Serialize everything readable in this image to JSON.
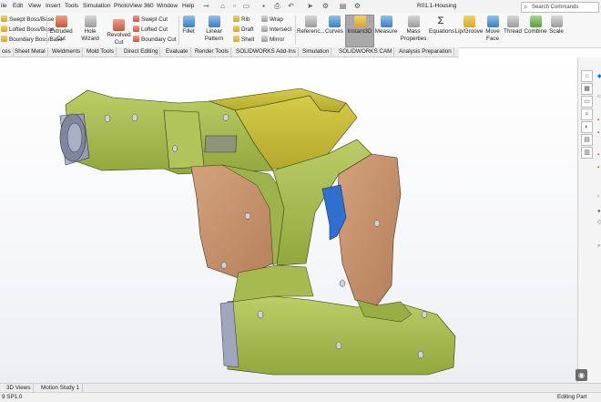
{
  "menubar": {
    "items": [
      "ile",
      "Edit",
      "View",
      "Insert",
      "Tools",
      "Simulation",
      "PhotoView 360",
      "Window",
      "Help"
    ],
    "doc_title": "R01.1-Housing",
    "search_placeholder": "Search Commands"
  },
  "ribbon": {
    "boss_group": [
      "Swept Boss/Base",
      "Lofted Boss/Base",
      "Boundary Boss/Base"
    ],
    "extruded_cut": "Extruded Cut",
    "hole_wizard": "Hole Wizard",
    "revolved_cut": "Revolved Cut",
    "cut_group": [
      "Swept Cut",
      "Lofted Cut",
      "Boundary Cut"
    ],
    "fillet": "Fillet",
    "linear_pattern": "Linear Pattern",
    "features_group": [
      "Rib",
      "Draft",
      "Shell"
    ],
    "features_group2": [
      "Wrap",
      "Intersect",
      "Mirror"
    ],
    "reference": "Referenc...",
    "curves": "Curves",
    "instant3d": "Instant3D",
    "measure": "Measure",
    "mass_properties": "Mass Properties",
    "equations": "Equations",
    "lip_groove": "Lip/Groove",
    "move_face": "Move Face",
    "thread": "Thread",
    "combine": "Combine",
    "scale": "Scale"
  },
  "tabs": [
    "ces",
    "Sheet Metal",
    "Weldments",
    "Mold Tools",
    "Direct Editing",
    "Evaluate",
    "Render Tools",
    "SOLIDWORKS Add-Ins",
    "Simulation",
    "SOLIDWORKS CAM",
    "Analysis Preparation"
  ],
  "bottom_tabs": [
    "3D Views",
    "Motion Study 1"
  ],
  "status": {
    "left": "9 SP1.0",
    "right": "Editing Part"
  },
  "colors": {
    "body_green": "#a9bd52",
    "grip_tan": "#c4906a",
    "trigger_blue": "#2f6fd0",
    "nozzle_gray": "#9fa6bd",
    "hood_olive": "#c7bd3a"
  }
}
